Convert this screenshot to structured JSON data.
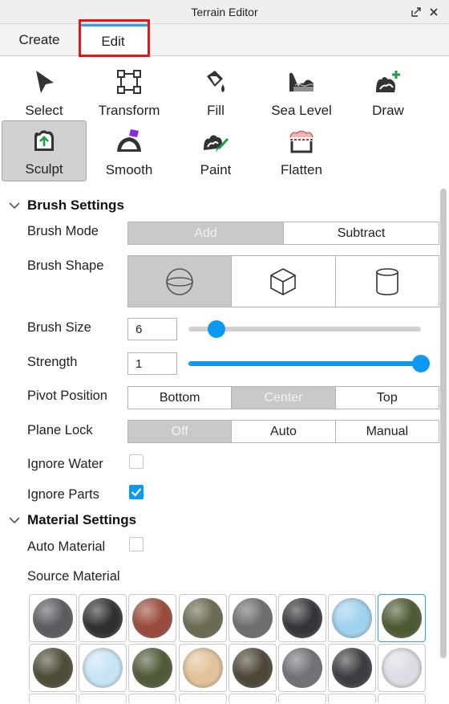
{
  "window": {
    "title": "Terrain Editor"
  },
  "tabs": [
    {
      "label": "Create",
      "selected": false
    },
    {
      "label": "Edit",
      "selected": true
    }
  ],
  "tools": [
    {
      "label": "Select",
      "icon": "select-arrow-icon"
    },
    {
      "label": "Transform",
      "icon": "transform-icon"
    },
    {
      "label": "Fill",
      "icon": "fill-bucket-icon"
    },
    {
      "label": "Sea Level",
      "icon": "sea-level-icon"
    },
    {
      "label": "Draw",
      "icon": "draw-icon"
    },
    {
      "label": "Sculpt",
      "icon": "sculpt-icon",
      "active": true
    },
    {
      "label": "Smooth",
      "icon": "smooth-icon"
    },
    {
      "label": "Paint",
      "icon": "paint-icon"
    },
    {
      "label": "Flatten",
      "icon": "flatten-icon"
    }
  ],
  "brush_settings": {
    "header": "Brush Settings",
    "brush_mode": {
      "label": "Brush Mode",
      "options": [
        "Add",
        "Subtract"
      ],
      "selected": "Add"
    },
    "brush_shape": {
      "label": "Brush Shape",
      "options": [
        "sphere-icon",
        "cube-icon",
        "cylinder-icon"
      ],
      "selected": "sphere-icon"
    },
    "brush_size": {
      "label": "Brush Size",
      "value": "6",
      "slider_fraction": 0.08
    },
    "strength": {
      "label": "Strength",
      "value": "1",
      "slider_fraction": 1.0
    },
    "pivot_position": {
      "label": "Pivot Position",
      "options": [
        "Bottom",
        "Center",
        "Top"
      ],
      "selected": "Center"
    },
    "plane_lock": {
      "label": "Plane Lock",
      "options": [
        "Off",
        "Auto",
        "Manual"
      ],
      "selected": "Off"
    },
    "ignore_water": {
      "label": "Ignore Water",
      "checked": false
    },
    "ignore_parts": {
      "label": "Ignore Parts",
      "checked": true
    }
  },
  "material_settings": {
    "header": "Material Settings",
    "auto_material": {
      "label": "Auto Material",
      "checked": false
    },
    "source_material": {
      "label": "Source Material"
    },
    "materials": [
      {
        "icon": "asphalt-material-icon",
        "color": "#5a5c60"
      },
      {
        "icon": "basalt-material-icon",
        "color": "#2f3032"
      },
      {
        "icon": "brick-material-icon",
        "color": "#9a4a3c"
      },
      {
        "icon": "cobblestone-material-icon",
        "color": "#6b6a52"
      },
      {
        "icon": "concrete-material-icon",
        "color": "#6e6e70"
      },
      {
        "icon": "crackedlava-material-icon",
        "color": "#333538"
      },
      {
        "icon": "glacier-material-icon",
        "color": "#9fd2ee"
      },
      {
        "icon": "grass-material-icon",
        "color": "#4c5a34",
        "selected": true
      },
      {
        "icon": "ground-material-icon",
        "color": "#4e4c36"
      },
      {
        "icon": "ice-material-icon",
        "color": "#c8e4f4"
      },
      {
        "icon": "leafygrass-material-icon",
        "color": "#4f5a38"
      },
      {
        "icon": "limestone-material-icon",
        "color": "#e2c29a"
      },
      {
        "icon": "mud-material-icon",
        "color": "#4d4738"
      },
      {
        "icon": "pavement-material-icon",
        "color": "#707276"
      },
      {
        "icon": "rock-material-icon",
        "color": "#3c3d40"
      },
      {
        "icon": "salt-material-icon",
        "color": "#dcdde4"
      }
    ]
  }
}
